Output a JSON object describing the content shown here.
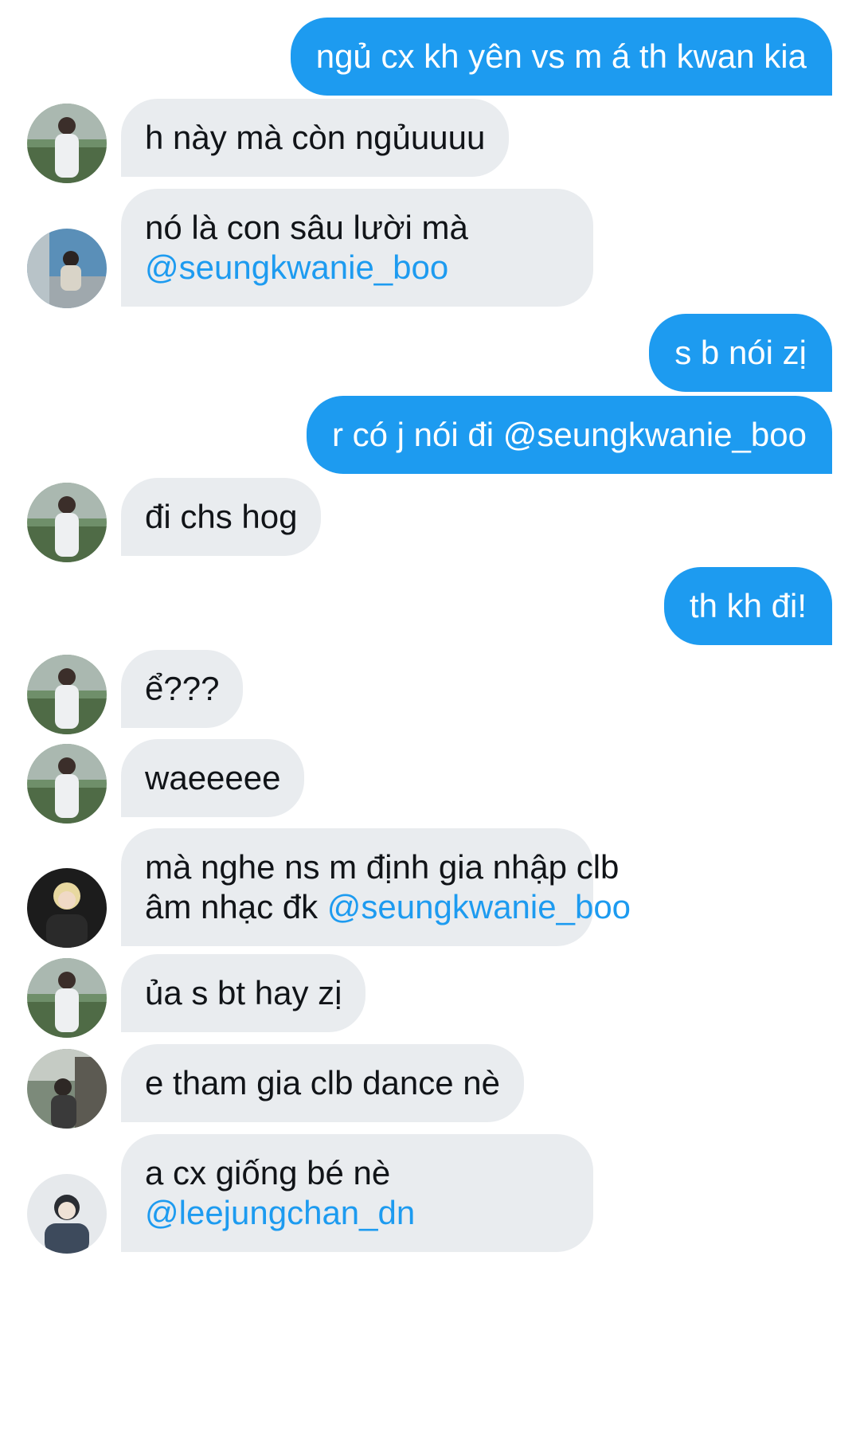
{
  "colors": {
    "outgoing_bubble": "#1d9bf0",
    "incoming_bubble": "#e9ecef",
    "mention": "#1d9bf0"
  },
  "messages": [
    {
      "direction": "out",
      "text": "ngủ cx kh yên vs m á th kwan kia"
    },
    {
      "direction": "in",
      "avatar": "user-a",
      "text": "h này mà còn ngủuuuu"
    },
    {
      "direction": "in",
      "avatar": "user-b",
      "line1": "nó là con sâu lười mà",
      "mention": "@seungkwanie_boo"
    },
    {
      "direction": "out",
      "text": "s b nói zị"
    },
    {
      "direction": "out",
      "text_before": "r có j nói đi ",
      "mention": "@seungkwanie_boo"
    },
    {
      "direction": "in",
      "avatar": "user-a",
      "text": "đi chs hog"
    },
    {
      "direction": "out",
      "text": "th kh đi!"
    },
    {
      "direction": "in",
      "avatar": "user-a",
      "text": "ể???"
    },
    {
      "direction": "in",
      "avatar": "user-a",
      "text": "waeeeee"
    },
    {
      "direction": "in",
      "avatar": "user-c",
      "line1": "mà nghe ns m định gia nhập clb",
      "line2": "âm nhạc đk ",
      "mention": "@seungkwanie_boo"
    },
    {
      "direction": "in",
      "avatar": "user-a",
      "text": "ủa s bt hay zị"
    },
    {
      "direction": "in",
      "avatar": "user-d",
      "text": "e tham gia clb dance nè"
    },
    {
      "direction": "in",
      "avatar": "user-e",
      "line1": "a cx giống bé nè",
      "mention": "@leejungchan_dn"
    }
  ]
}
